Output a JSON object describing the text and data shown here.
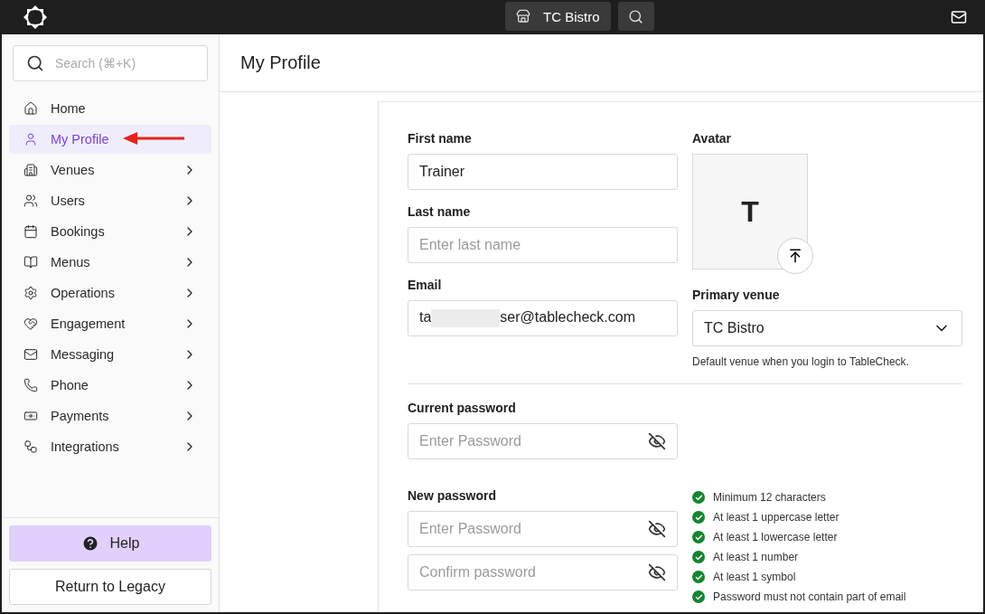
{
  "topbar": {
    "venue": "TC Bistro"
  },
  "sidebar": {
    "search": {
      "placeholder": "Search (⌘+K)"
    },
    "items": [
      {
        "label": "Home",
        "selected": false,
        "expandable": false
      },
      {
        "label": "My Profile",
        "selected": true,
        "expandable": false
      },
      {
        "label": "Venues",
        "selected": false,
        "expandable": true
      },
      {
        "label": "Users",
        "selected": false,
        "expandable": true
      },
      {
        "label": "Bookings",
        "selected": false,
        "expandable": true
      },
      {
        "label": "Menus",
        "selected": false,
        "expandable": true
      },
      {
        "label": "Operations",
        "selected": false,
        "expandable": true
      },
      {
        "label": "Engagement",
        "selected": false,
        "expandable": true
      },
      {
        "label": "Messaging",
        "selected": false,
        "expandable": true
      },
      {
        "label": "Phone",
        "selected": false,
        "expandable": true
      },
      {
        "label": "Payments",
        "selected": false,
        "expandable": true
      },
      {
        "label": "Integrations",
        "selected": false,
        "expandable": true
      }
    ],
    "help": "Help",
    "legacy": "Return to Legacy"
  },
  "page": {
    "title": "My Profile"
  },
  "form": {
    "first_name": {
      "label": "First name",
      "value": "Trainer"
    },
    "last_name": {
      "label": "Last name",
      "placeholder": "Enter last name"
    },
    "email": {
      "label": "Email",
      "value_before": "ta",
      "value_after": "ser@tablecheck.com",
      "redacted": true
    },
    "avatar": {
      "label": "Avatar",
      "initial": "T"
    },
    "primary_venue": {
      "label": "Primary venue",
      "value": "TC Bistro",
      "hint": "Default venue when you login to TableCheck."
    },
    "current_password": {
      "label": "Current password",
      "placeholder": "Enter Password"
    },
    "new_password": {
      "label": "New password",
      "placeholder": "Enter Password",
      "confirm_placeholder": "Confirm password"
    },
    "rules": [
      {
        "text": "Minimum 12 characters",
        "met": true
      },
      {
        "text": "At least 1 uppercase letter",
        "met": true
      },
      {
        "text": "At least 1 lowercase letter",
        "met": true
      },
      {
        "text": "At least 1 number",
        "met": true
      },
      {
        "text": "At least 1 symbol",
        "met": true
      },
      {
        "text": "Password must not contain part of email",
        "met": true
      }
    ]
  }
}
